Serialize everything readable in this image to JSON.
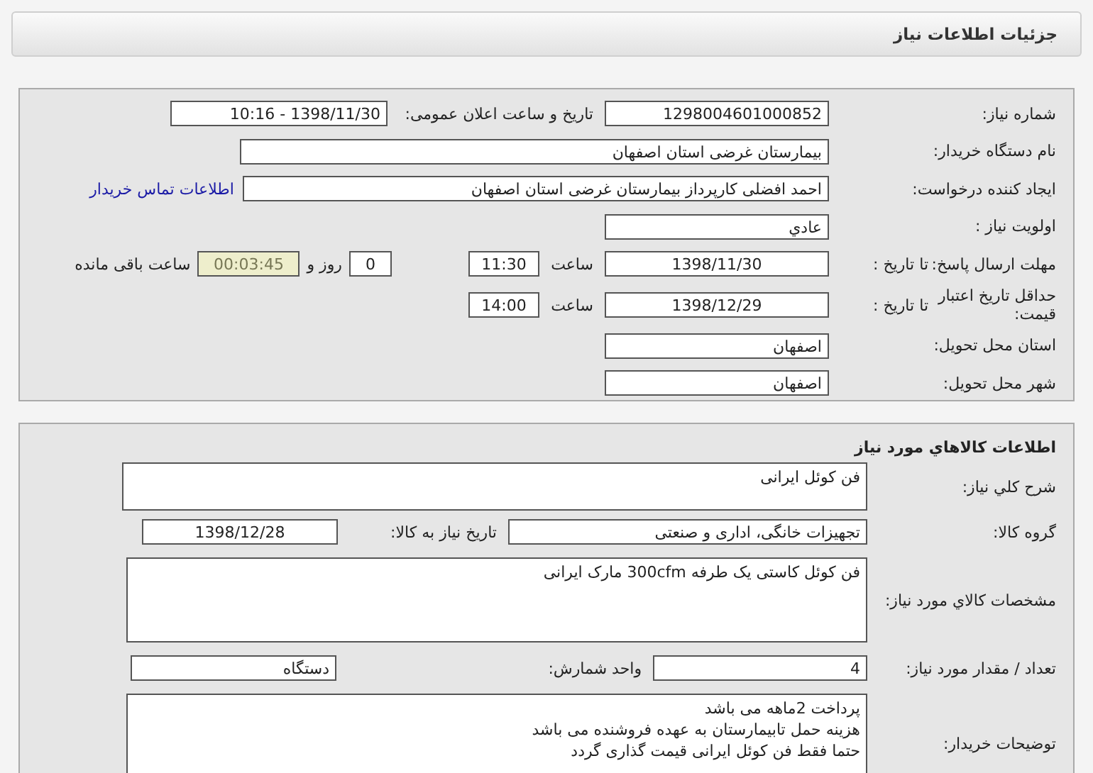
{
  "page_title": "جزئیات اطلاعات نیاز",
  "need_info": {
    "need_number": {
      "label": "شماره نیاز:",
      "value": "1298004601000852"
    },
    "announce": {
      "label": "تاریخ و ساعت اعلان عمومی:",
      "value": "1398/11/30 - 10:16"
    },
    "buyer": {
      "label": "نام دستگاه خریدار:",
      "value": "بیمارستان غرضی استان اصفهان"
    },
    "requester": {
      "label": "ایجاد کننده درخواست:",
      "value": "احمد افضلی کارپرداز بیمارستان غرضی استان اصفهان"
    },
    "contact_link": "اطلاعات تماس خریدار",
    "priority": {
      "label": "اولویت نیاز :",
      "value": "عادي"
    },
    "deadline": {
      "label": "مهلت ارسال پاسخ:",
      "date_label": "تا تاریخ :",
      "date": "1398/11/30",
      "time_label": "ساعت",
      "time": "11:30",
      "days": "0",
      "days_label": "روز و",
      "remaining": "00:03:45",
      "remaining_label": "ساعت باقی مانده"
    },
    "validity": {
      "label": "حداقل تاریخ اعتبار قیمت:",
      "date_label": "تا تاریخ :",
      "date": "1398/12/29",
      "time_label": "ساعت",
      "time": "14:00"
    },
    "province": {
      "label": "استان محل تحویل:",
      "value": "اصفهان"
    },
    "city": {
      "label": "شهر محل تحویل:",
      "value": "اصفهان"
    }
  },
  "goods": {
    "title": "اطلاعات كالاهاي مورد نياز",
    "summary": {
      "label": "شرح كلي نياز:",
      "value": "فن کوئل ایرانی"
    },
    "group": {
      "label": "گروه کالا:",
      "value": "تجهیزات خانگی، اداری و صنعتی"
    },
    "need_date": {
      "label": "تاریخ نیاز به کالا:",
      "value": "1398/12/28"
    },
    "spec": {
      "label": "مشخصات كالاي مورد نياز:",
      "value": "فن کوئل کاستی یک طرفه 300cfm مارک ایرانی"
    },
    "quantity": {
      "label": "تعداد / مقدار مورد نیاز:",
      "value": "4"
    },
    "unit": {
      "label": "واحد شمارش:",
      "value": "دستگاه"
    },
    "notes": {
      "label": "توضیحات خریدار:",
      "lines": [
        "پرداخت 2ماهه می باشد",
        "هزینه حمل تابیمارستان به عهده فروشنده می باشد",
        "حتما فقط فن کوئل ایرانی قیمت گذاری گردد"
      ]
    }
  }
}
